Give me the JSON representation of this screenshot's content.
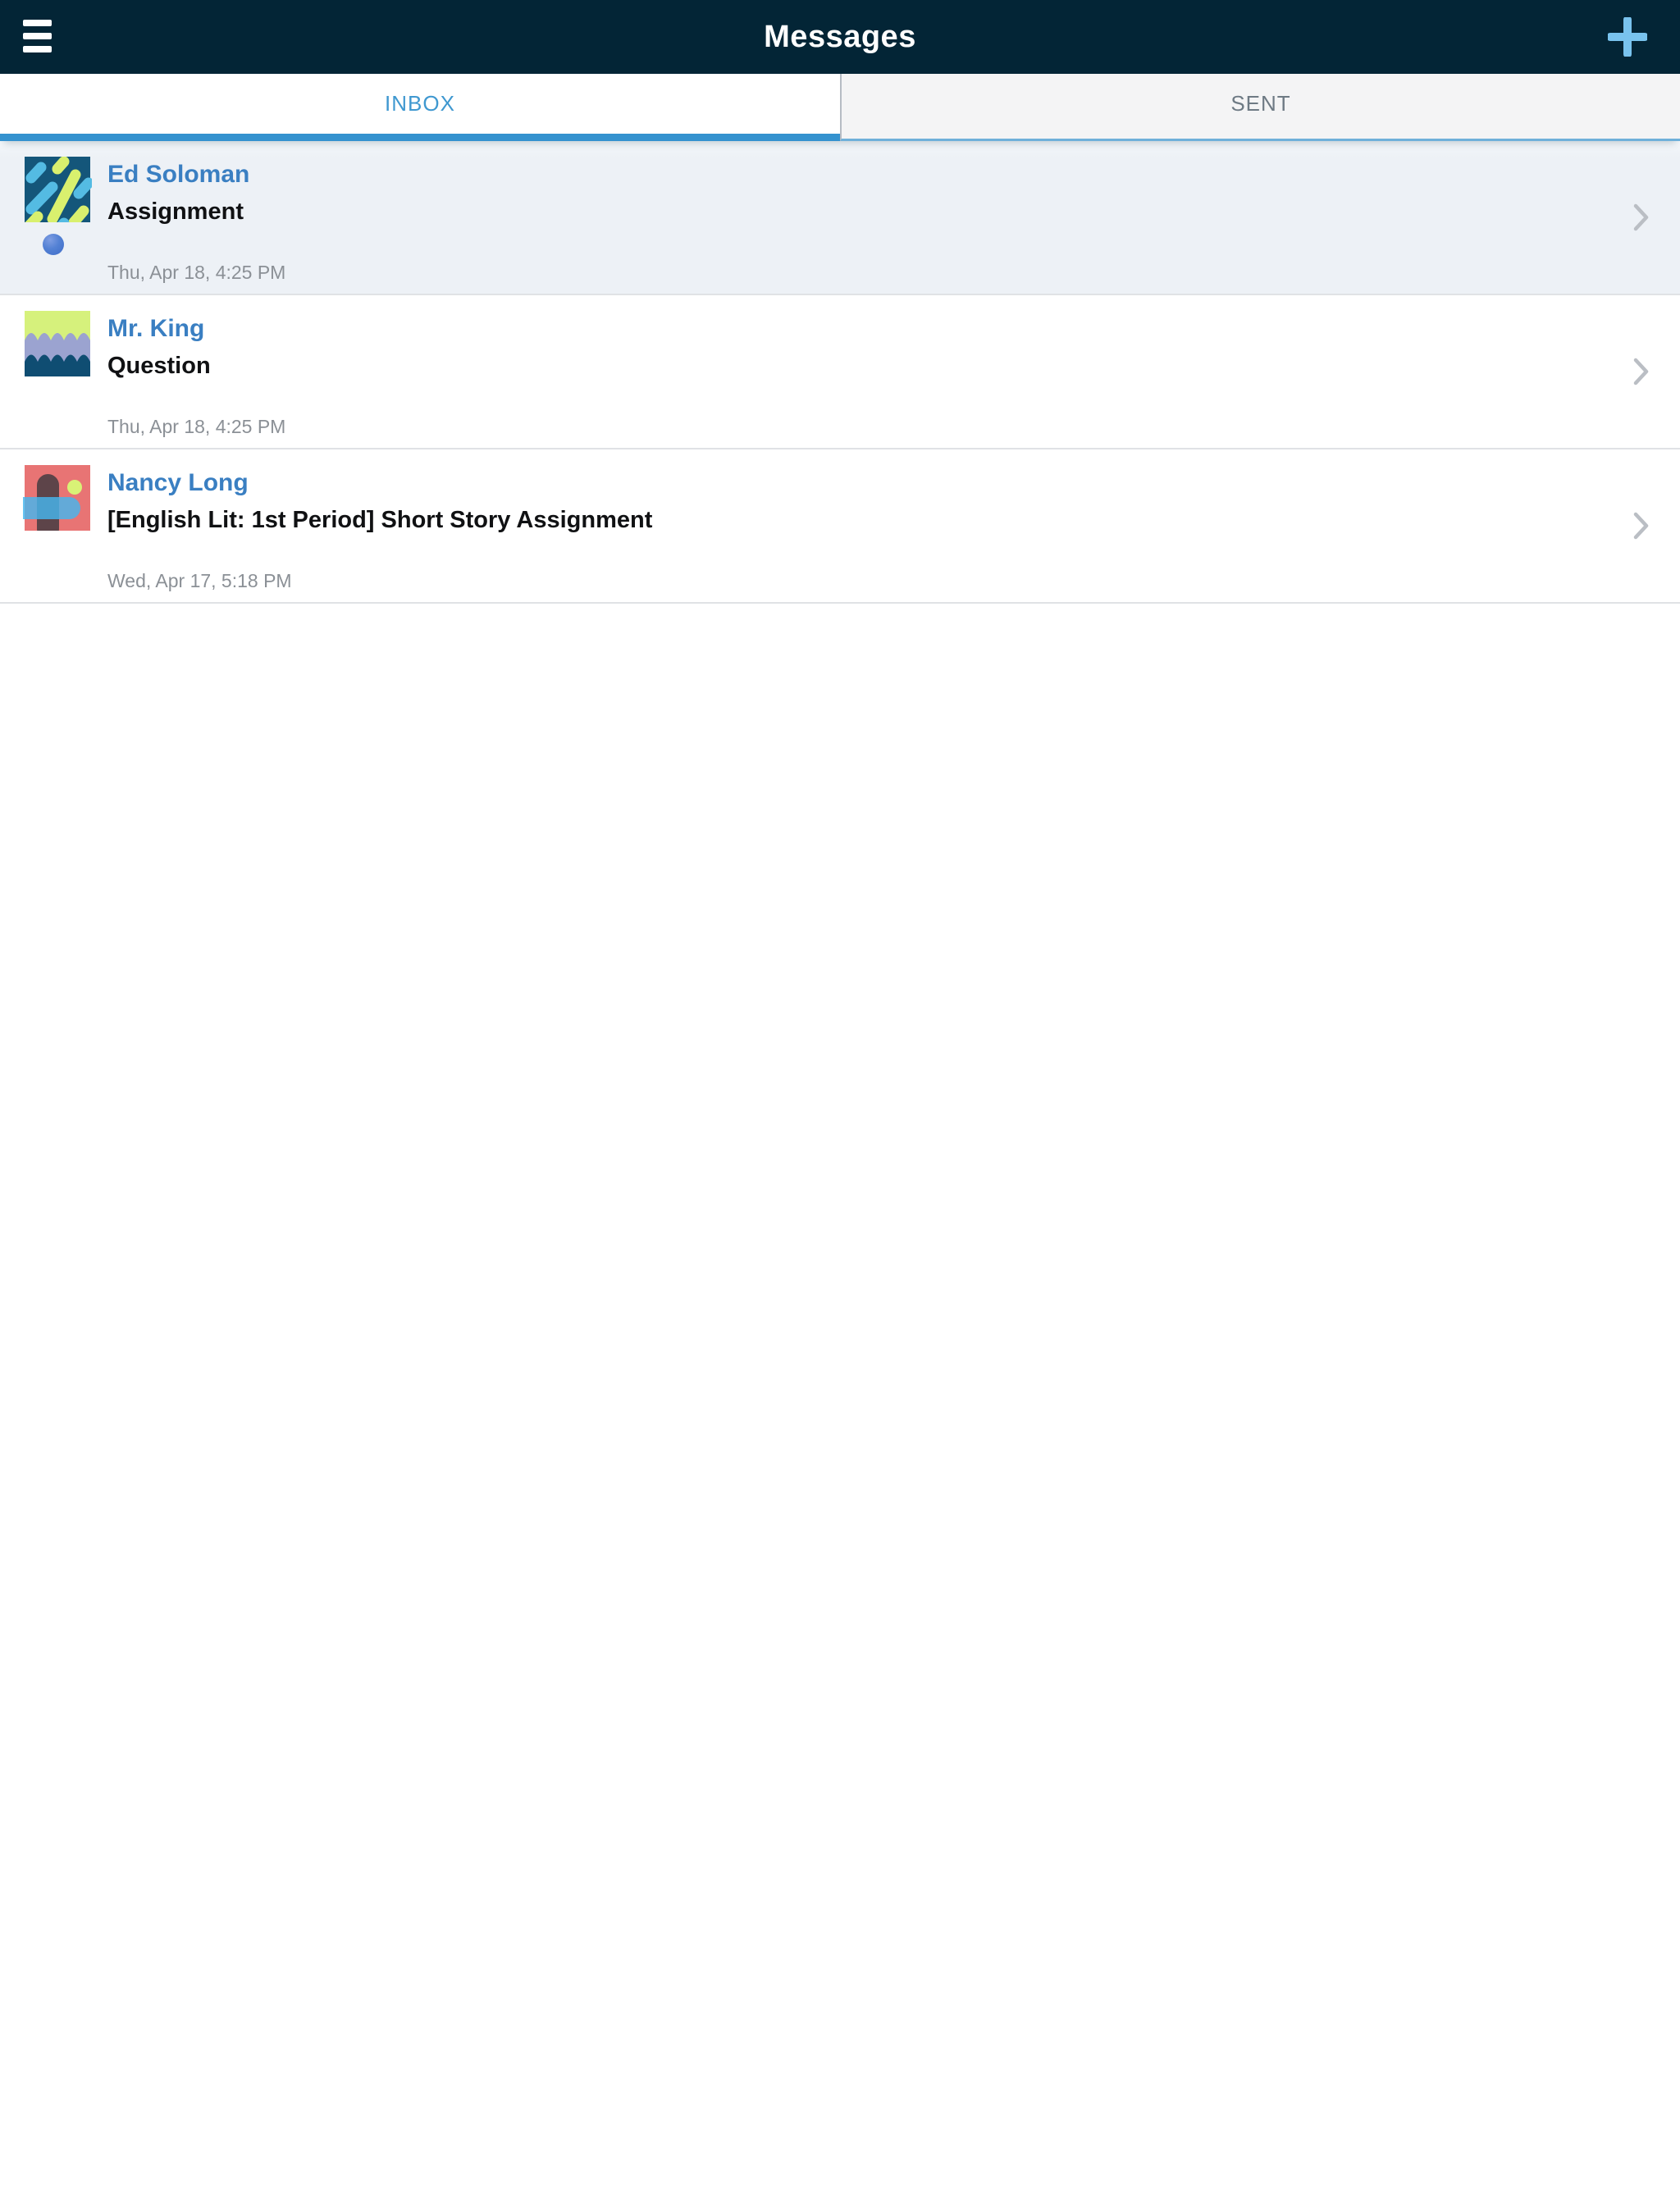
{
  "header": {
    "title": "Messages",
    "menu_icon": "hamburger-icon",
    "compose_icon": "plus-icon"
  },
  "tabs": [
    {
      "label": "INBOX",
      "active": true
    },
    {
      "label": "SENT",
      "active": false
    }
  ],
  "messages": [
    {
      "sender": "Ed Soloman",
      "subject": "Assignment",
      "timestamp": "Thu, Apr 18, 4:25 PM",
      "unread": true,
      "avatar": "diagonal-stripes-pattern"
    },
    {
      "sender": "Mr. King",
      "subject": "Question",
      "timestamp": "Thu, Apr 18, 4:25 PM",
      "unread": false,
      "avatar": "waves-pattern"
    },
    {
      "sender": "Nancy Long",
      "subject": "[English Lit: 1st Period] Short Story Assignment",
      "timestamp": "Wed, Apr 17, 5:18 PM",
      "unread": false,
      "avatar": "shapes-pattern"
    }
  ],
  "colors": {
    "header_bg": "#032536",
    "accent_plus": "#79c3ee",
    "tab_active_text": "#3f98d0",
    "tab_active_underline": "#3492cf",
    "tab_inactive_bg": "#f4f4f5",
    "tab_inactive_text": "#6e7a84",
    "unread_row_bg": "#edf1f6",
    "sender_blue": "#3a7fc2",
    "timestamp_gray": "#8b9096",
    "unread_dot": "#3f6cc8",
    "chevron_gray": "#babec4"
  }
}
